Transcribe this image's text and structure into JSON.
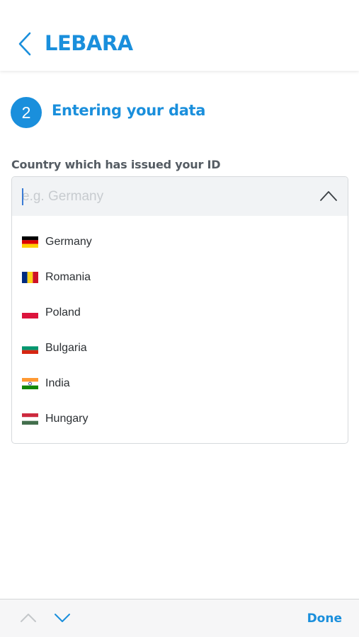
{
  "header": {
    "logo_text": "LEBARA",
    "back_icon": "chevron-left-icon",
    "accent_color": "#1a8fdc"
  },
  "step": {
    "number": "2",
    "title": "Entering your data"
  },
  "form": {
    "country_label": "Country which has issued your ID",
    "country_placeholder": "e.g. Germany",
    "country_value": ""
  },
  "dropdown": {
    "toggle_icon": "chevron-up-icon",
    "options": [
      {
        "label": "Germany",
        "flag": "germany-flag-icon",
        "colors": [
          "#000000",
          "#dd0000",
          "#ffce00"
        ]
      },
      {
        "label": "Romania",
        "flag": "romania-flag-icon",
        "colors": [
          "#002b7f",
          "#fcd116",
          "#ce1126"
        ]
      },
      {
        "label": "Poland",
        "flag": "poland-flag-icon",
        "colors": [
          "#ffffff",
          "#dc143c"
        ]
      },
      {
        "label": "Bulgaria",
        "flag": "bulgaria-flag-icon",
        "colors": [
          "#ffffff",
          "#00966e",
          "#d62612"
        ]
      },
      {
        "label": "India",
        "flag": "india-flag-icon",
        "colors": [
          "#ff9933",
          "#ffffff",
          "#138808"
        ]
      },
      {
        "label": "Hungary",
        "flag": "hungary-flag-icon",
        "colors": [
          "#cd2a3e",
          "#ffffff",
          "#436f4d"
        ]
      }
    ]
  },
  "keyboard_bar": {
    "prev_icon": "chevron-up-icon",
    "next_icon": "chevron-down-icon",
    "done_label": "Done"
  }
}
